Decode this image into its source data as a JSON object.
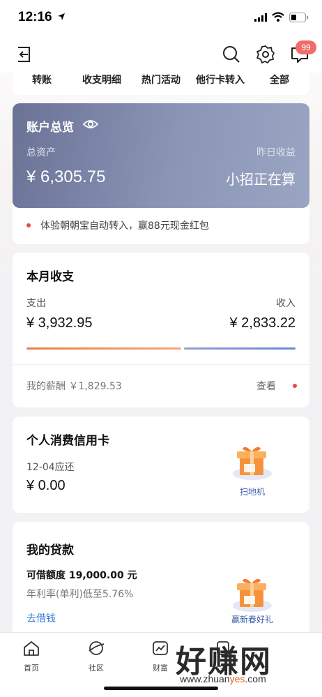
{
  "status_bar": {
    "time": "12:16"
  },
  "nav": {
    "badge_count": "99"
  },
  "quick_links": [
    "转账",
    "收支明细",
    "热门活动",
    "他行卡转入",
    "全部"
  ],
  "account": {
    "title": "账户总览",
    "total_label": "总资产",
    "total_amount": "¥ 6,305.75",
    "yesterday_label": "昨日收益",
    "yesterday_value": "小招正在算",
    "promo": "体验朝朝宝自动转入，赢88元现金红包"
  },
  "monthly": {
    "title": "本月收支",
    "expense_label": "支出",
    "expense_amount": "¥ 3,932.95",
    "income_label": "收入",
    "income_amount": "¥ 2,833.22",
    "salary": "我的薪酬 ￥1,829.53",
    "view": "查看"
  },
  "credit": {
    "title": "个人消费信用卡",
    "due_label": "12-04应还",
    "due_amount": "¥ 0.00",
    "gift_label": "扫地机"
  },
  "loan": {
    "title": "我的贷款",
    "limit": "可借额度 19,000.00 元",
    "rate": "年利率(单利)低至5.76%",
    "borrow": "去借钱",
    "gift_label": "赢新春好礼"
  },
  "tabs": [
    {
      "label": "首页",
      "icon": "home-icon"
    },
    {
      "label": "社区",
      "icon": "community-icon"
    },
    {
      "label": "财富",
      "icon": "wealth-icon"
    },
    {
      "label": "生",
      "icon": "life-icon"
    }
  ],
  "watermark": {
    "big": "好赚网",
    "small_a": "www.zhuan",
    "small_b": "yes",
    "small_c": ".com"
  },
  "colors": {
    "accent_red": "#ea4a3a",
    "link_blue": "#3a7bd5",
    "card_gradient_start": "#6a7396",
    "card_gradient_end": "#9aa5c3"
  }
}
